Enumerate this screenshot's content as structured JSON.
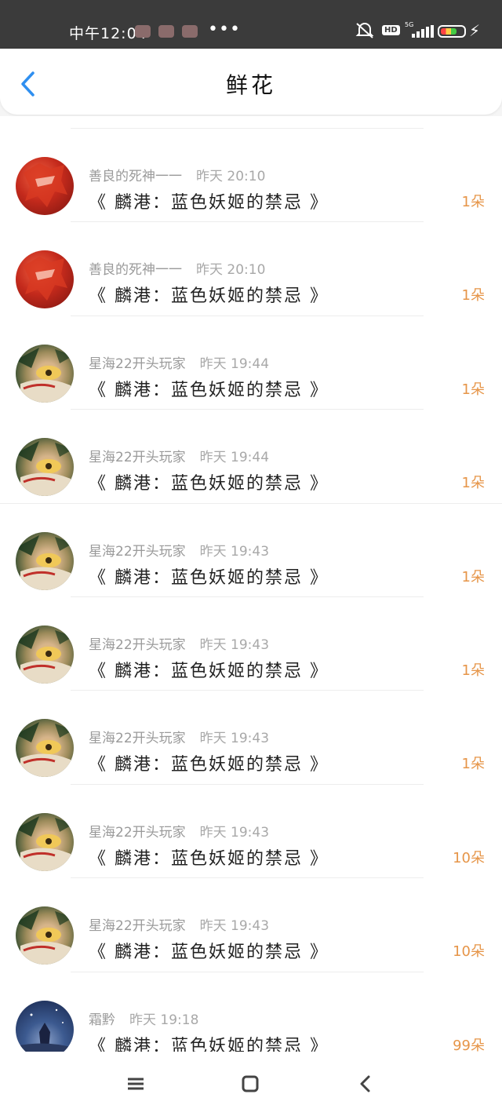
{
  "status_bar": {
    "time": "中午12:04",
    "more": "•••",
    "hd": "HD",
    "network": "5G"
  },
  "header": {
    "title": "鲜花"
  },
  "list": [
    {
      "user": "善良的死神一一",
      "time": "昨天 20:10",
      "book": "《 麟港：蓝色妖姬的禁忌 》",
      "amount": "1朵",
      "avatar": "red-hair-avatar"
    },
    {
      "user": "善良的死神一一",
      "time": "昨天 20:10",
      "book": "《 麟港：蓝色妖姬的禁忌 》",
      "amount": "1朵",
      "avatar": "red-hair-avatar"
    },
    {
      "user": "星海22开头玩家",
      "time": "昨天 19:44",
      "book": "《 麟港：蓝色妖姬的禁忌 》",
      "amount": "1朵",
      "avatar": "anime-eye-avatar"
    },
    {
      "user": "星海22开头玩家",
      "time": "昨天 19:44",
      "book": "《 麟港：蓝色妖姬的禁忌 》",
      "amount": "1朵",
      "avatar": "anime-eye-avatar"
    },
    {
      "user": "星海22开头玩家",
      "time": "昨天 19:43",
      "book": "《 麟港：蓝色妖姬的禁忌 》",
      "amount": "1朵",
      "avatar": "anime-eye-avatar"
    },
    {
      "user": "星海22开头玩家",
      "time": "昨天 19:43",
      "book": "《 麟港：蓝色妖姬的禁忌 》",
      "amount": "1朵",
      "avatar": "anime-eye-avatar"
    },
    {
      "user": "星海22开头玩家",
      "time": "昨天 19:43",
      "book": "《 麟港：蓝色妖姬的禁忌 》",
      "amount": "1朵",
      "avatar": "anime-eye-avatar"
    },
    {
      "user": "星海22开头玩家",
      "time": "昨天 19:43",
      "book": "《 麟港：蓝色妖姬的禁忌 》",
      "amount": "10朵",
      "avatar": "anime-eye-avatar"
    },
    {
      "user": "星海22开头玩家",
      "time": "昨天 19:43",
      "book": "《 麟港：蓝色妖姬的禁忌 》",
      "amount": "10朵",
      "avatar": "anime-eye-avatar"
    },
    {
      "user": "霜黔",
      "time": "昨天 19:18",
      "book": "《 麟港：蓝色妖姬的禁忌 》",
      "amount": "99朵",
      "avatar": "night-sky-avatar"
    }
  ],
  "colors": {
    "accent_blue": "#2f8ff0",
    "amount_orange": "#e69548",
    "status_bar_bg": "#3b3b3b"
  },
  "icons": {
    "back": "chevron-left-icon",
    "menu": "hamburger-menu-icon",
    "home": "rounded-square-home-icon",
    "system_back": "chevron-left-icon"
  }
}
